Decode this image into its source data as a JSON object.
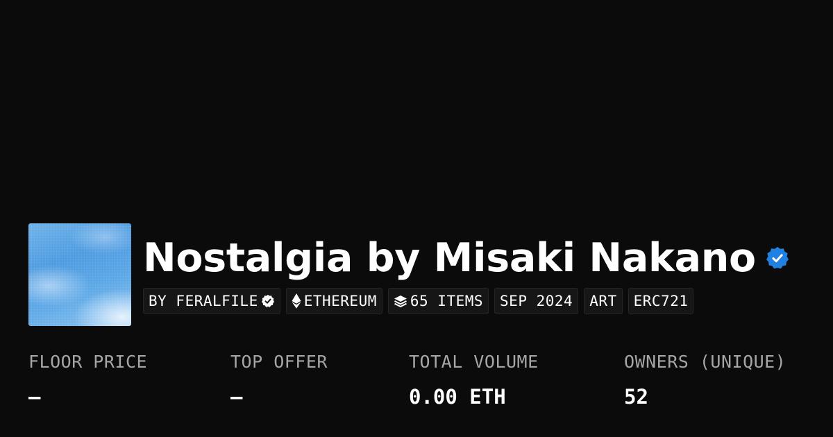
{
  "collection": {
    "title": "Nostalgia by Misaki Nakano",
    "verified_icon": "verified-badge-icon",
    "thumbnail_icon": "collection-thumbnail"
  },
  "tags": [
    {
      "label": "BY FERALFILE",
      "icon": "verified-check-icon"
    },
    {
      "label": "ETHEREUM",
      "icon": "ethereum-icon"
    },
    {
      "label": "65 ITEMS",
      "icon": "layers-icon"
    },
    {
      "label": "SEP 2024"
    },
    {
      "label": "ART"
    },
    {
      "label": "ERC721"
    }
  ],
  "stats": [
    {
      "label": "FLOOR PRICE",
      "value": "—"
    },
    {
      "label": "TOP OFFER",
      "value": "—"
    },
    {
      "label": "TOTAL VOLUME",
      "value": "0.00 ETH"
    },
    {
      "label": "OWNERS (UNIQUE)",
      "value": "52"
    }
  ],
  "colors": {
    "background": "#0b0b0b",
    "verified_blue": "#2081e2",
    "label_gray": "#a6a6a6",
    "tag_background": "#161616"
  }
}
